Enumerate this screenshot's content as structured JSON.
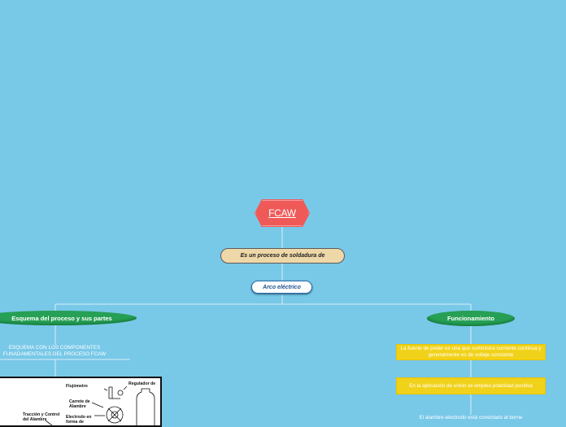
{
  "root": {
    "label": "FCAW",
    "color": "#ef5a59"
  },
  "definition": {
    "label": "Es un proceso de soldadura de"
  },
  "subtype": {
    "label": "Arco eléctrico"
  },
  "branches": {
    "left": {
      "label": "Esquema del proceso y sus partes",
      "caption": "ESQUEMA CON LOS COMPONENTES FUNADAMENTALES DEL PROCESO FCAW",
      "figure_labels": {
        "flowmeter": "Flujómetro",
        "regulator": "Regulador de",
        "spool": "Carrete de Alambre",
        "traction": "Tracción y Control del Alambre",
        "electrode": "Electrodo en forma de"
      }
    },
    "right": {
      "label": "Funcionamiento",
      "items": [
        "La fuente de poder es una que suministra corriente continua y generalmente es de voltaje constante",
        "En la aplicación de unión se emplea polaridad positiva",
        "El alambre-electrodo está conectado al borne"
      ]
    }
  },
  "colors": {
    "background": "#78c8e8",
    "branch_green": "#27a056",
    "item_yellow": "#f1d21a",
    "definition_tan": "#eed7a8"
  }
}
